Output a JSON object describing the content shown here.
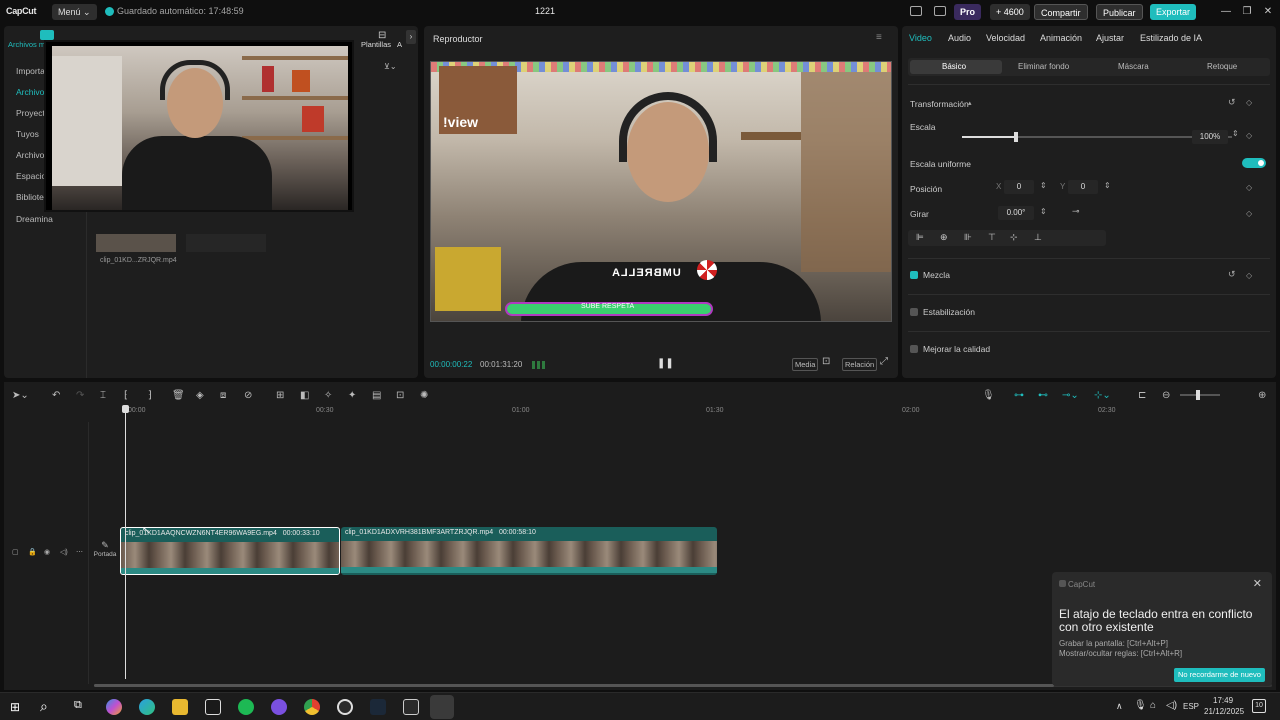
{
  "topbar": {
    "logo": "CapCut",
    "menu": "Menú ⌄",
    "autosave": "Guardado automático: 17:48:59",
    "project_title": "1221",
    "pro": "Pro",
    "credits": "+ 4600",
    "share": "Compartir",
    "publish": "Publicar",
    "export": "Exportar"
  },
  "left_panel": {
    "toolbar_cut_label": "Archivos m",
    "templates": "Plantillas",
    "templates_more": "A",
    "sidebar": [
      {
        "label": "Importa"
      },
      {
        "label": "Archivo"
      },
      {
        "label": "Proyect"
      },
      {
        "label": "Tuyos"
      },
      {
        "label": "Archivo"
      },
      {
        "label": "Espacio"
      },
      {
        "label": "Bibliote"
      },
      {
        "label": "Dreamina"
      }
    ],
    "media_filename": "clip_01KD...ZRJQR.mp4"
  },
  "player": {
    "title": "Reproductor",
    "time_current": "00:00:00:22",
    "time_total": "00:01:31:20",
    "overlay_text": "!view",
    "bar_text": "SUBE RESPETA",
    "shirt_text": "UMBRELLA",
    "btn_media": "Media",
    "btn_ratio": "Relación"
  },
  "props": {
    "tabs": [
      "Video",
      "Audio",
      "Velocidad",
      "Animación",
      "Ajustar",
      "Estilizado de IA"
    ],
    "subtabs": [
      "Básico",
      "Eliminar fondo",
      "Máscara",
      "Retoque"
    ],
    "transform": "Transformación",
    "scale": "Escala",
    "scale_value": "100%",
    "uniform": "Escala uniforme",
    "position": "Posición",
    "pos_x_label": "X",
    "pos_x": "0",
    "pos_y_label": "Y",
    "pos_y": "0",
    "rotate": "Girar",
    "rotate_value": "0.00°",
    "blend": "Mezcla",
    "stabilize": "Estabilización",
    "quality": "Mejorar la calidad",
    "scale_fraction": 0.2
  },
  "timeline": {
    "ruler": [
      "00:00",
      "00:30",
      "01:00",
      "01:30",
      "02:00",
      "02:30"
    ],
    "cover": "Portada",
    "clips": [
      {
        "name": "clip_01KD1AAQNCWZN6NT4ER96WA9EG.mp4",
        "duration": "00:00:33:10"
      },
      {
        "name": "clip_01KD1ADXVRH381BMF3ARTZRJQR.mp4",
        "duration": "00:00:58:10"
      }
    ]
  },
  "toast": {
    "app": "CapCut",
    "title": "El atajo de teclado entra en conflicto con otro existente",
    "line1": "Grabar la pantalla: [Ctrl+Alt+P]",
    "line2": "Mostrar/ocultar reglas: [Ctrl+Alt+R]",
    "button": "No recordarme de nuevo"
  },
  "taskbar": {
    "lang": "ESP",
    "time": "17:49",
    "date": "21/12/2025",
    "notif": "10"
  },
  "colors": {
    "accent": "#1fbdbd",
    "panel": "#1e1e1e",
    "clip": "#1a5e5a"
  }
}
